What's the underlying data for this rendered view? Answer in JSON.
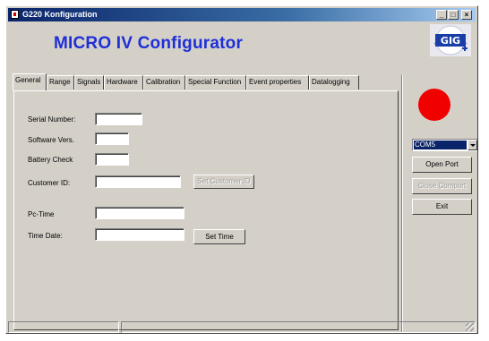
{
  "window": {
    "title": "G220 Konfiguration"
  },
  "header": {
    "title": "MICRO IV Configurator",
    "logo_text": "GIG"
  },
  "tabs": [
    {
      "label": "General",
      "active": true
    },
    {
      "label": "Range"
    },
    {
      "label": "Signals"
    },
    {
      "label": "Hardware"
    },
    {
      "label": "Calibration"
    },
    {
      "label": "Special Function"
    },
    {
      "label": "Event properties"
    },
    {
      "label": "Datalogging"
    }
  ],
  "general": {
    "serial_number_label": "Serial Number:",
    "serial_number_value": "",
    "software_version_label": "Software Vers.",
    "software_version_value": "",
    "battery_check_label": "Battery Check",
    "battery_check_value": "",
    "customer_id_label": "Customer ID:",
    "customer_id_value": "",
    "set_customer_id_button": "Set Customer ID",
    "pc_time_label": "Pc-Time",
    "pc_time_value": "",
    "time_date_label": "Time Date:",
    "time_date_value": "",
    "set_time_button": "Set Time"
  },
  "side": {
    "status_led_color": "#f10000",
    "com_port": "COM5",
    "open_port_button": "Open Port",
    "close_comport_button": "Close Comport",
    "exit_button": "Exit"
  },
  "colors": {
    "title_blue": "#1e2fd8",
    "face": "#d4d0c8"
  }
}
